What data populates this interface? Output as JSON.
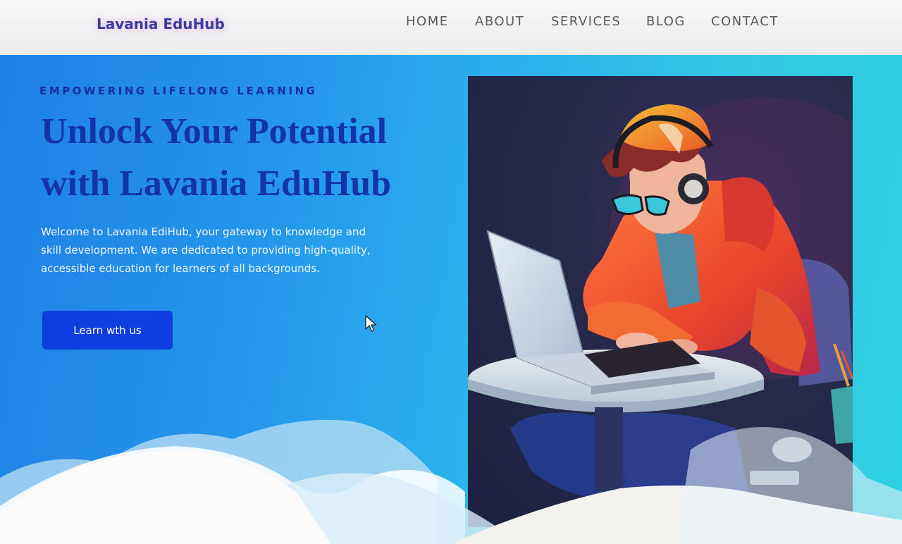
{
  "header": {
    "logo": "Lavania EduHub",
    "nav": [
      {
        "label": "HOME"
      },
      {
        "label": "ABOUT"
      },
      {
        "label": "SERVICES"
      },
      {
        "label": "BLOG"
      },
      {
        "label": "CONTACT"
      }
    ]
  },
  "hero": {
    "eyebrow": "EMPOWERING LIFELONG LEARNING",
    "headline_line1": "Unlock Your Potential",
    "headline_line2": "with Lavania EduHub",
    "intro_line1": "Welcome to Lavania EdiHub, your gateway to knowledge and",
    "intro_line2": "skill development. We are dedicated to providing high-quality,",
    "intro_line3": "accessible education for learners of all backgrounds.",
    "cta_label": "Learn wth us"
  },
  "colors": {
    "brand": "#1533a8",
    "button": "#0d3fe0",
    "hero_start": "#1f7fe6",
    "hero_end": "#2ed0df",
    "hoodie": "#e8442a",
    "cap": "#f08a1e"
  },
  "icons": {
    "cursor": "mouse-pointer-icon",
    "illustration": "student-with-laptop-illustration"
  }
}
